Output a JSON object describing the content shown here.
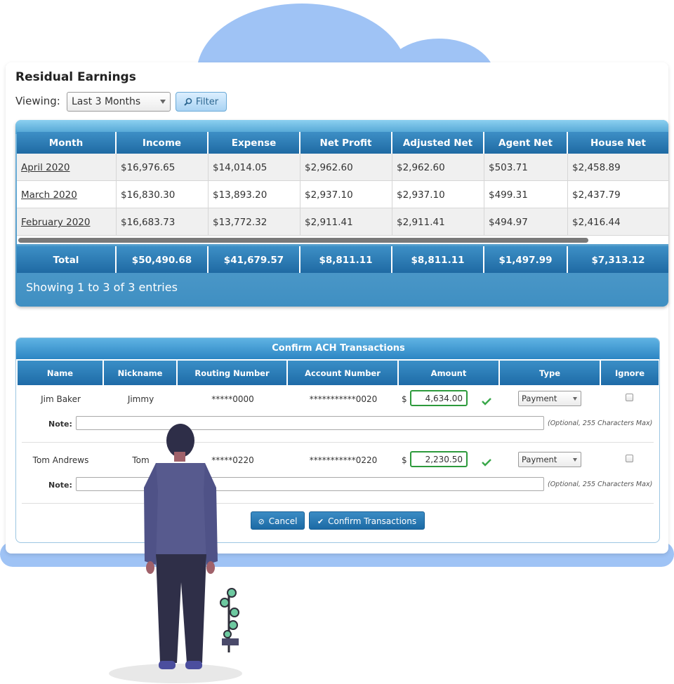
{
  "page": {
    "title": "Residual Earnings",
    "viewing_label": "Viewing:",
    "viewing_value": "Last 3 Months",
    "filter_label": "Filter"
  },
  "residual_table": {
    "headers": [
      "Month",
      "Income",
      "Expense",
      "Net Profit",
      "Adjusted Net",
      "Agent Net",
      "House Net"
    ],
    "rows": [
      [
        "April 2020",
        "$16,976.65",
        "$14,014.05",
        "$2,962.60",
        "$2,962.60",
        "$503.71",
        "$2,458.89"
      ],
      [
        "March 2020",
        "$16,830.30",
        "$13,893.20",
        "$2,937.10",
        "$2,937.10",
        "$499.31",
        "$2,437.79"
      ],
      [
        "February 2020",
        "$16,683.73",
        "$13,772.32",
        "$2,911.41",
        "$2,911.41",
        "$494.97",
        "$2,416.44"
      ]
    ],
    "totals": [
      "Total",
      "$50,490.68",
      "$41,679.57",
      "$8,811.11",
      "$8,811.11",
      "$1,497.99",
      "$7,313.12"
    ],
    "entries_info": "Showing 1 to 3 of 3 entries"
  },
  "ach": {
    "title": "Confirm ACH Transactions",
    "headers": [
      "Name",
      "Nickname",
      "Routing Number",
      "Account Number",
      "Amount",
      "Type",
      "Ignore"
    ],
    "rows": [
      {
        "name": "Jim Baker",
        "nickname": "Jimmy",
        "routing": "*****0000",
        "account": "***********0020",
        "currency": "$",
        "amount": "4,634.00",
        "type": "Payment",
        "note_label": "Note:",
        "note_hint": "(Optional, 255 Characters Max)",
        "ignored": false
      },
      {
        "name": "Tom Andrews",
        "nickname": "Tom",
        "routing": "*****0220",
        "account": "***********0220",
        "currency": "$",
        "amount": "2,230.50",
        "type": "Payment",
        "note_label": "Note:",
        "note_hint": "(Optional, 255 Characters Max)",
        "ignored": false
      }
    ],
    "cancel_label": "Cancel",
    "confirm_label": "Confirm Transactions"
  },
  "colors": {
    "header_blue": "#1f6aa3",
    "cloud_blue": "#9fc3f5",
    "valid_green": "#2d9a3c"
  },
  "icons": {
    "filter": "search-icon",
    "cancel": "cancel-circle-icon",
    "confirm": "checkmark-icon",
    "valid": "checkmark-icon"
  }
}
